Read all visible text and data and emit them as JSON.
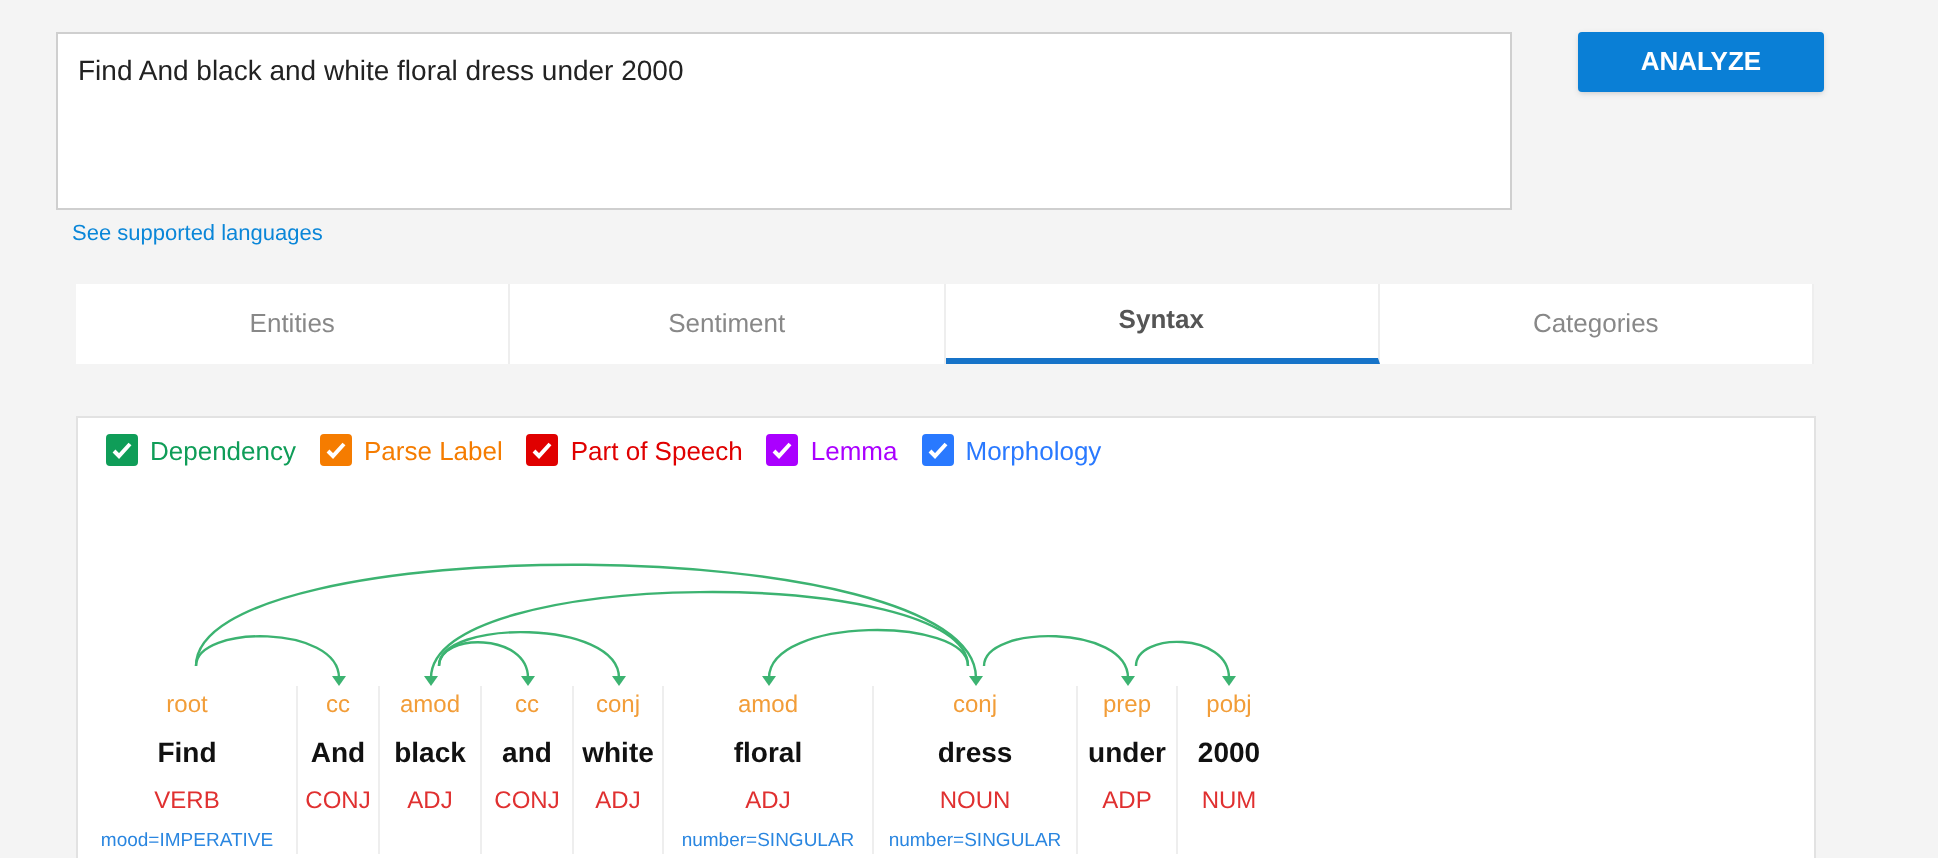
{
  "input": {
    "value": "Find And black and white floral dress under 2000"
  },
  "analyze_button": "ANALYZE",
  "languages_link": "See supported languages",
  "tabs": [
    {
      "label": "Entities",
      "selected": false
    },
    {
      "label": "Sentiment",
      "selected": false
    },
    {
      "label": "Syntax",
      "selected": true
    },
    {
      "label": "Categories",
      "selected": false
    }
  ],
  "legend": [
    {
      "label": "Dependency",
      "checked": true,
      "color": "#0f9d58"
    },
    {
      "label": "Parse Label",
      "checked": true,
      "color": "#f57c00"
    },
    {
      "label": "Part of Speech",
      "checked": true,
      "color": "#e00000"
    },
    {
      "label": "Lemma",
      "checked": true,
      "color": "#aa00ff"
    },
    {
      "label": "Morphology",
      "checked": true,
      "color": "#2979ff"
    }
  ],
  "tokens": [
    {
      "label": "root",
      "word": "Find",
      "pos": "VERB",
      "morphology": "mood=IMPERATIVE"
    },
    {
      "label": "cc",
      "word": "And",
      "pos": "CONJ"
    },
    {
      "label": "amod",
      "word": "black",
      "pos": "ADJ"
    },
    {
      "label": "cc",
      "word": "and",
      "pos": "CONJ"
    },
    {
      "label": "conj",
      "word": "white",
      "pos": "ADJ"
    },
    {
      "label": "amod",
      "word": "floral",
      "pos": "ADJ",
      "morphology": "number=SINGULAR"
    },
    {
      "label": "conj",
      "word": "dress",
      "pos": "NOUN",
      "morphology": "number=SINGULAR"
    },
    {
      "label": "prep",
      "word": "under",
      "pos": "ADP"
    },
    {
      "label": "pobj",
      "word": "2000",
      "pos": "NUM"
    }
  ]
}
